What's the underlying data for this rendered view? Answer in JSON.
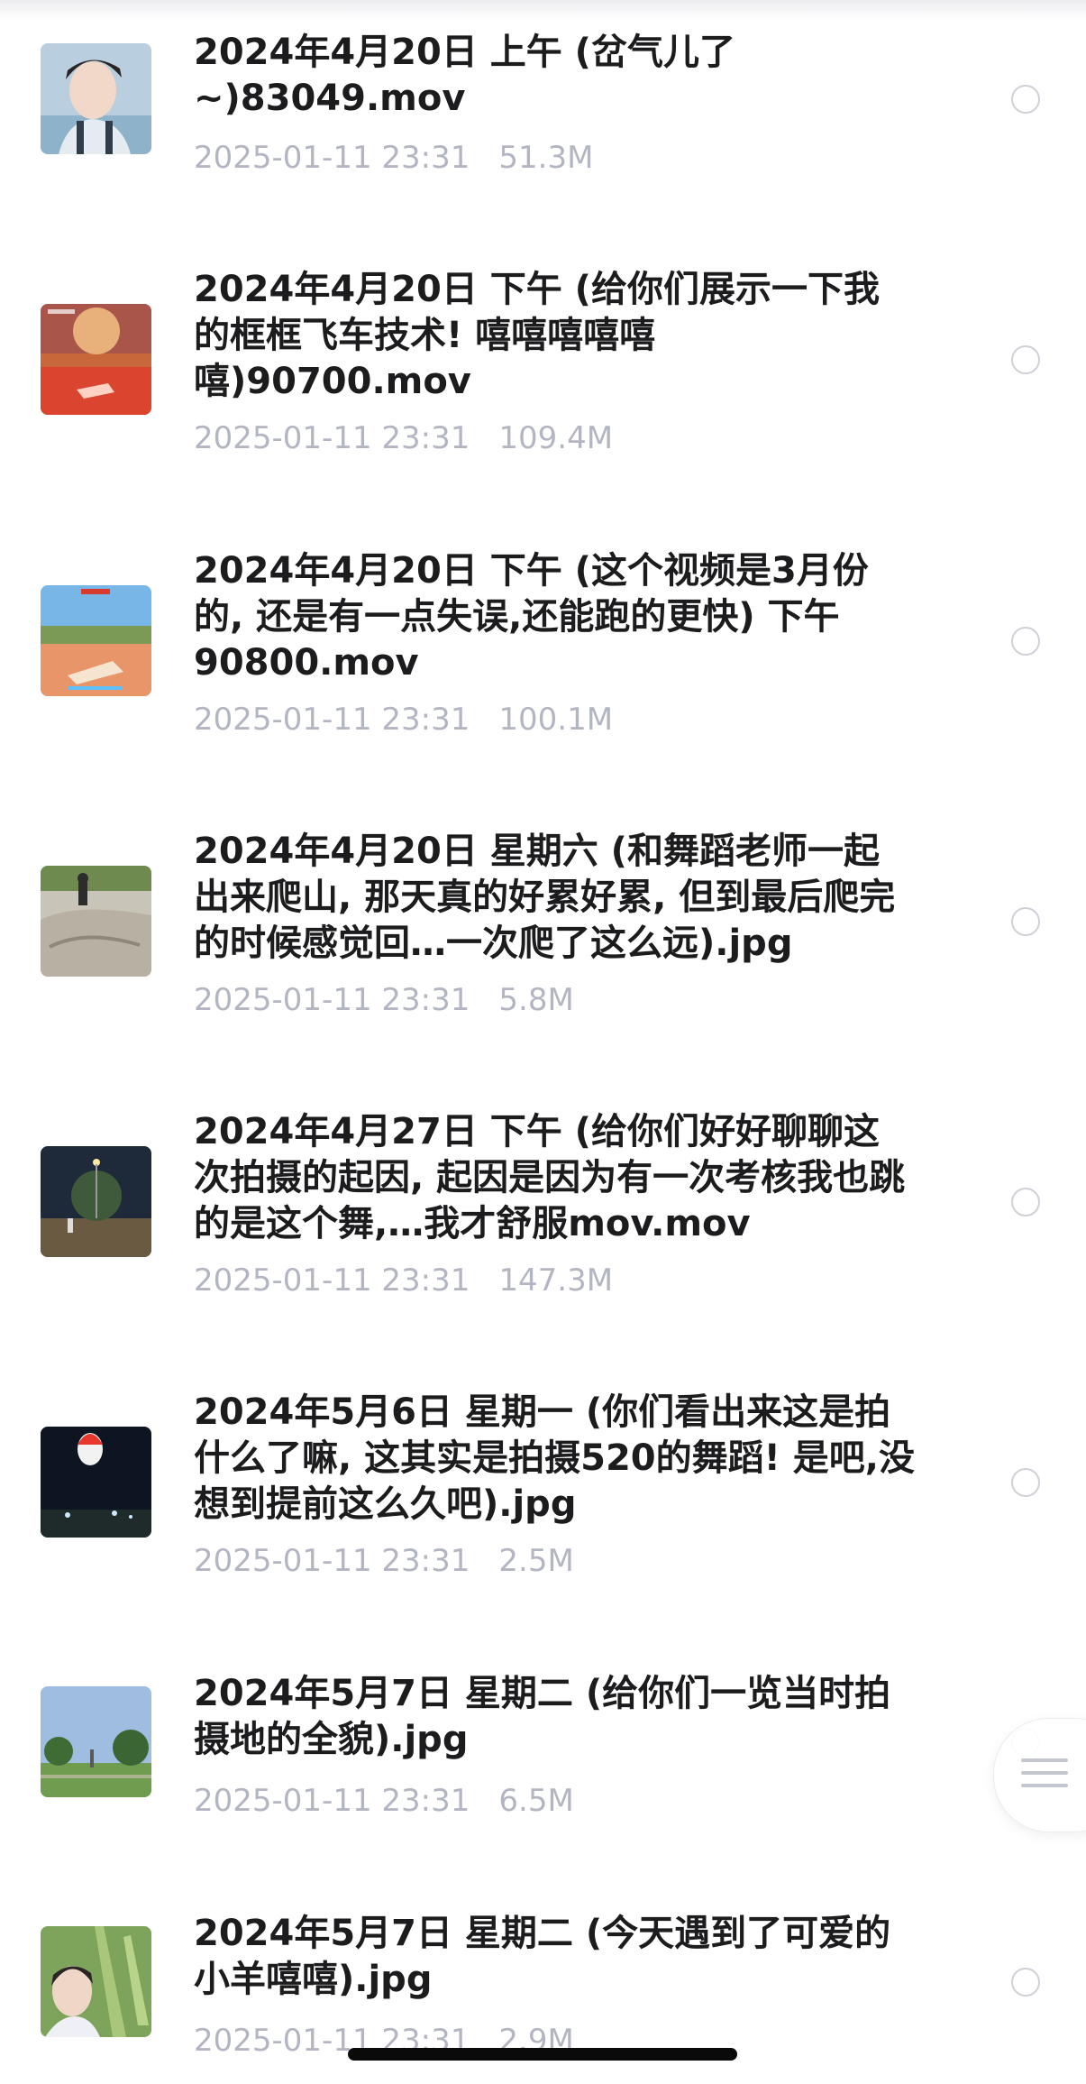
{
  "files": [
    {
      "title": "2024年4月20日 上午 (岔气儿了~)83049.mov",
      "date": "2025-01-11 23:31",
      "size": "51.3M",
      "thumb": "selfie-outdoor"
    },
    {
      "title": "2024年4月20日 下午 (给你们展示一下我的框框飞车技术! 嘻嘻嘻嘻嘻嘻)90700.mov",
      "date": "2025-01-11 23:31",
      "size": "109.4M",
      "thumb": "racing-game"
    },
    {
      "title": "2024年4月20日 下午 (这个视频是3月份的, 还是有一点失误,还能跑的更快) 下午90800.mov",
      "date": "2025-01-11 23:31",
      "size": "100.1M",
      "thumb": "racing-game"
    },
    {
      "title": "2024年4月20日 星期六 (和舞蹈老师一起出来爬山, 那天真的好累好累, 但到最后爬完的时候感觉回…一次爬了这么远).jpg",
      "date": "2025-01-11 23:31",
      "size": "5.8M",
      "thumb": "rocky-hill"
    },
    {
      "title": "2024年4月27日 下午 (给你们好好聊聊这次拍摄的起因, 起因是因为有一次考核我也跳的是这个舞,…我才舒服mov.mov",
      "date": "2025-01-11 23:31",
      "size": "147.3M",
      "thumb": "night-park"
    },
    {
      "title": "2024年5月6日 星期一 (你们看出来这是拍什么了嘛, 这其实是拍摄520的舞蹈! 是吧,没想到提前这么久吧).jpg",
      "date": "2025-01-11 23:31",
      "size": "2.5M",
      "thumb": "night-sky"
    },
    {
      "title": "2024年5月7日 星期二 (给你们一览当时拍摄地的全貌).jpg",
      "date": "2025-01-11 23:31",
      "size": "6.5M",
      "thumb": "park-day"
    },
    {
      "title": "2024年5月7日 星期二 (今天遇到了可爱的小羊嘻嘻).jpg",
      "date": "2025-01-11 23:31",
      "size": "2.9M",
      "thumb": "selfie-leaves"
    }
  ]
}
